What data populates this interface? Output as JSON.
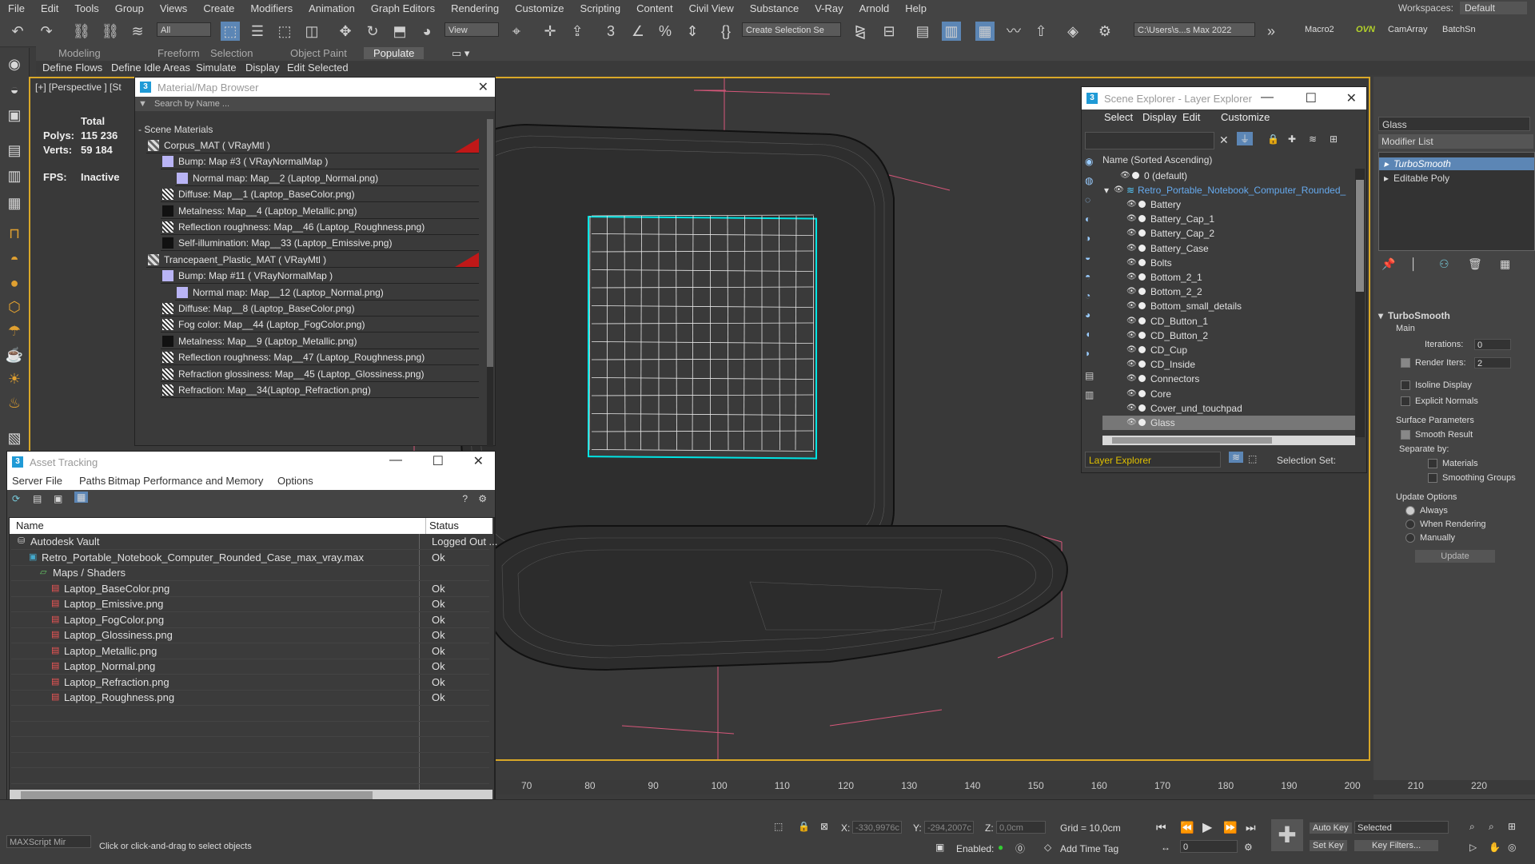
{
  "menu": [
    "File",
    "Edit",
    "Tools",
    "Group",
    "Views",
    "Create",
    "Modifiers",
    "Animation",
    "Graph Editors",
    "Rendering",
    "Customize",
    "Scripting",
    "Content",
    "Civil View",
    "Substance",
    "V-Ray",
    "Arnold",
    "Help"
  ],
  "workspaces": {
    "label": "Workspaces:",
    "value": "Default"
  },
  "toolbar": {
    "filter": "All",
    "ref_coord": "View",
    "selection_set": "Create Selection Se",
    "project_path": "C:\\Users\\s...s Max 2022",
    "macro2": "Macro2",
    "ovn": "OVN",
    "camarray": "CamArray",
    "batchsn": "BatchSn"
  },
  "ribbon_tabs": [
    "Modeling",
    "Freeform",
    "Selection",
    "Object Paint",
    "Populate"
  ],
  "ribbon_sub": [
    "Define Flows",
    "Define Idle Areas",
    "Simulate",
    "Display",
    "Edit Selected"
  ],
  "viewport": {
    "label": "[+] [Perspective ] [St",
    "stats": {
      "total_label": "Total",
      "polys_label": "Polys:",
      "polys": "115 236",
      "verts_label": "Verts:",
      "verts": "59 184",
      "fps_label": "FPS:",
      "fps": "Inactive"
    }
  },
  "material_browser": {
    "title": "Material/Map Browser",
    "search_placeholder": "Search by Name ...",
    "group": "- Scene Materials",
    "rows": [
      {
        "text": "Corpus_MAT  ( VRayMtl )",
        "indent": 0,
        "swatch": "mat",
        "red": true
      },
      {
        "text": "Bump: Map #3  ( VRayNormalMap )",
        "indent": 1,
        "swatch": "lav"
      },
      {
        "text": "Normal map: Map__2 (Laptop_Normal.png)",
        "indent": 2,
        "swatch": "lav"
      },
      {
        "text": "Diffuse: Map__1 (Laptop_BaseColor.png)",
        "indent": 1,
        "swatch": "img"
      },
      {
        "text": "Metalness: Map__4 (Laptop_Metallic.png)",
        "indent": 1,
        "swatch": "dark"
      },
      {
        "text": "Reflection roughness: Map__46 (Laptop_Roughness.png)",
        "indent": 1,
        "swatch": "img"
      },
      {
        "text": "Self-illumination: Map__33 (Laptop_Emissive.png)",
        "indent": 1,
        "swatch": "dark"
      },
      {
        "text": "Trancepaent_Plastic_MAT  ( VRayMtl )",
        "indent": 0,
        "swatch": "mat",
        "red": true
      },
      {
        "text": "Bump: Map #11  ( VRayNormalMap )",
        "indent": 1,
        "swatch": "lav"
      },
      {
        "text": "Normal map: Map__12 (Laptop_Normal.png)",
        "indent": 2,
        "swatch": "lav"
      },
      {
        "text": "Diffuse: Map__8 (Laptop_BaseColor.png)",
        "indent": 1,
        "swatch": "img"
      },
      {
        "text": "Fog color: Map__44 (Laptop_FogColor.png)",
        "indent": 1,
        "swatch": "img"
      },
      {
        "text": "Metalness: Map__9 (Laptop_Metallic.png)",
        "indent": 1,
        "swatch": "dark"
      },
      {
        "text": "Reflection roughness: Map__47 (Laptop_Roughness.png)",
        "indent": 1,
        "swatch": "img"
      },
      {
        "text": "Refraction glossiness: Map__45 (Laptop_Glossiness.png)",
        "indent": 1,
        "swatch": "img"
      },
      {
        "text": "Refraction: Map__34(Laptop_Refraction.png)",
        "indent": 1,
        "swatch": "img"
      }
    ]
  },
  "asset_tracking": {
    "title": "Asset Tracking",
    "menu": [
      "Server",
      "File",
      "Paths",
      "Bitmap Performance and Memory",
      "Options"
    ],
    "col_name": "Name",
    "col_status": "Status",
    "rows": [
      {
        "name": "Autodesk Vault",
        "status": "Logged Out ...",
        "indent": 0,
        "icon": "vault"
      },
      {
        "name": "Retro_Portable_Notebook_Computer_Rounded_Case_max_vray.max",
        "status": "Ok",
        "indent": 1,
        "icon": "max"
      },
      {
        "name": "Maps / Shaders",
        "status": "",
        "indent": 2,
        "icon": "folder"
      },
      {
        "name": "Laptop_BaseColor.png",
        "status": "Ok",
        "indent": 3,
        "icon": "png"
      },
      {
        "name": "Laptop_Emissive.png",
        "status": "Ok",
        "indent": 3,
        "icon": "png"
      },
      {
        "name": "Laptop_FogColor.png",
        "status": "Ok",
        "indent": 3,
        "icon": "png"
      },
      {
        "name": "Laptop_Glossiness.png",
        "status": "Ok",
        "indent": 3,
        "icon": "png"
      },
      {
        "name": "Laptop_Metallic.png",
        "status": "Ok",
        "indent": 3,
        "icon": "png"
      },
      {
        "name": "Laptop_Normal.png",
        "status": "Ok",
        "indent": 3,
        "icon": "png"
      },
      {
        "name": "Laptop_Refraction.png",
        "status": "Ok",
        "indent": 3,
        "icon": "png"
      },
      {
        "name": "Laptop_Roughness.png",
        "status": "Ok",
        "indent": 3,
        "icon": "png"
      }
    ]
  },
  "scene_explorer": {
    "title": "Scene Explorer - Layer Explorer",
    "menu": [
      "Select",
      "Display",
      "Edit",
      "Customize"
    ],
    "col_header": "Name (Sorted Ascending)",
    "default_layer": "0 (default)",
    "root": "Retro_Portable_Notebook_Computer_Rounded_",
    "items": [
      "Battery",
      "Battery_Cap_1",
      "Battery_Cap_2",
      "Battery_Case",
      "Bolts",
      "Bottom_2_1",
      "Bottom_2_2",
      "Bottom_small_details",
      "CD_Button_1",
      "CD_Button_2",
      "CD_Cup",
      "CD_Inside",
      "Connectors",
      "Core",
      "Cover_und_touchpad",
      "Glass"
    ],
    "selected": "Glass",
    "footer_combo": "Layer Explorer",
    "footer_label": "Selection Set:"
  },
  "command_panel": {
    "object_name": "Glass",
    "modifier_list": "Modifier List",
    "stack": [
      "TurboSmooth",
      "Editable Poly"
    ],
    "rollout": "TurboSmooth",
    "main": "Main",
    "iterations_label": "Iterations:",
    "iterations": "0",
    "render_iters_label": "Render Iters:",
    "render_iters": "2",
    "isoline": "Isoline Display",
    "explicit": "Explicit Normals",
    "surface": "Surface Parameters",
    "smooth_result": "Smooth Result",
    "separate_by": "Separate by:",
    "materials": "Materials",
    "smoothing_groups": "Smoothing Groups",
    "update_options": "Update Options",
    "always": "Always",
    "when_rendering": "When Rendering",
    "manually": "Manually",
    "update": "Update"
  },
  "timeline_ticks": [
    "70",
    "80",
    "90",
    "100",
    "110",
    "120",
    "130",
    "140",
    "150",
    "160",
    "170",
    "180",
    "190",
    "200",
    "210",
    "220"
  ],
  "status": {
    "maxscript": "MAXScript Mir",
    "prompt": "Click or click-and-drag to select objects",
    "x_label": "X:",
    "x": "-330,9976c",
    "y_label": "Y:",
    "y": "-294,2007c",
    "z_label": "Z:",
    "z": "0,0cm",
    "grid": "Grid = 10,0cm",
    "enabled": "Enabled:",
    "add_time_tag": "Add Time Tag",
    "autokey": "Auto Key",
    "setkey": "Set Key",
    "selected": "Selected",
    "keyfilters": "Key Filters...",
    "frame": "0"
  }
}
